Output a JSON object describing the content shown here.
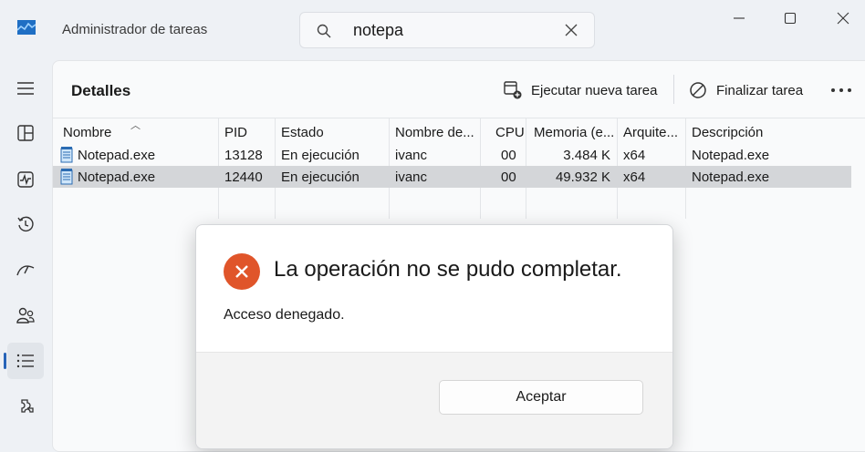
{
  "window": {
    "title": "Administrador de tareas"
  },
  "search": {
    "value": "notepa"
  },
  "colors": {
    "accent": "#2764b8",
    "error": "#e0552a",
    "selected_row": "#d4d6d9"
  },
  "nav": {
    "items": [
      {
        "name": "menu-icon"
      },
      {
        "name": "processes-icon"
      },
      {
        "name": "performance-icon"
      },
      {
        "name": "app-history-icon"
      },
      {
        "name": "startup-apps-icon"
      },
      {
        "name": "users-icon"
      },
      {
        "name": "details-icon",
        "active": true
      },
      {
        "name": "services-icon"
      }
    ]
  },
  "page": {
    "title": "Detalles",
    "run_task": "Ejecutar nueva tarea",
    "end_task": "Finalizar tarea"
  },
  "table": {
    "columns": [
      "Nombre",
      "PID",
      "Estado",
      "Nombre de...",
      "CPU",
      "Memoria (e...",
      "Arquite...",
      "Descripción"
    ],
    "rows": [
      {
        "name": "Notepad.exe",
        "pid": "13128",
        "status": "En ejecución",
        "user": "ivanc",
        "cpu": "00",
        "memory": "3.484 K",
        "arch": "x64",
        "desc": "Notepad.exe",
        "selected": false
      },
      {
        "name": "Notepad.exe",
        "pid": "12440",
        "status": "En ejecución",
        "user": "ivanc",
        "cpu": "00",
        "memory": "49.932 K",
        "arch": "x64",
        "desc": "Notepad.exe",
        "selected": true
      }
    ]
  },
  "dialog": {
    "title": "La operación no se pudo completar.",
    "message": "Acceso denegado.",
    "ok_label": "Aceptar"
  }
}
